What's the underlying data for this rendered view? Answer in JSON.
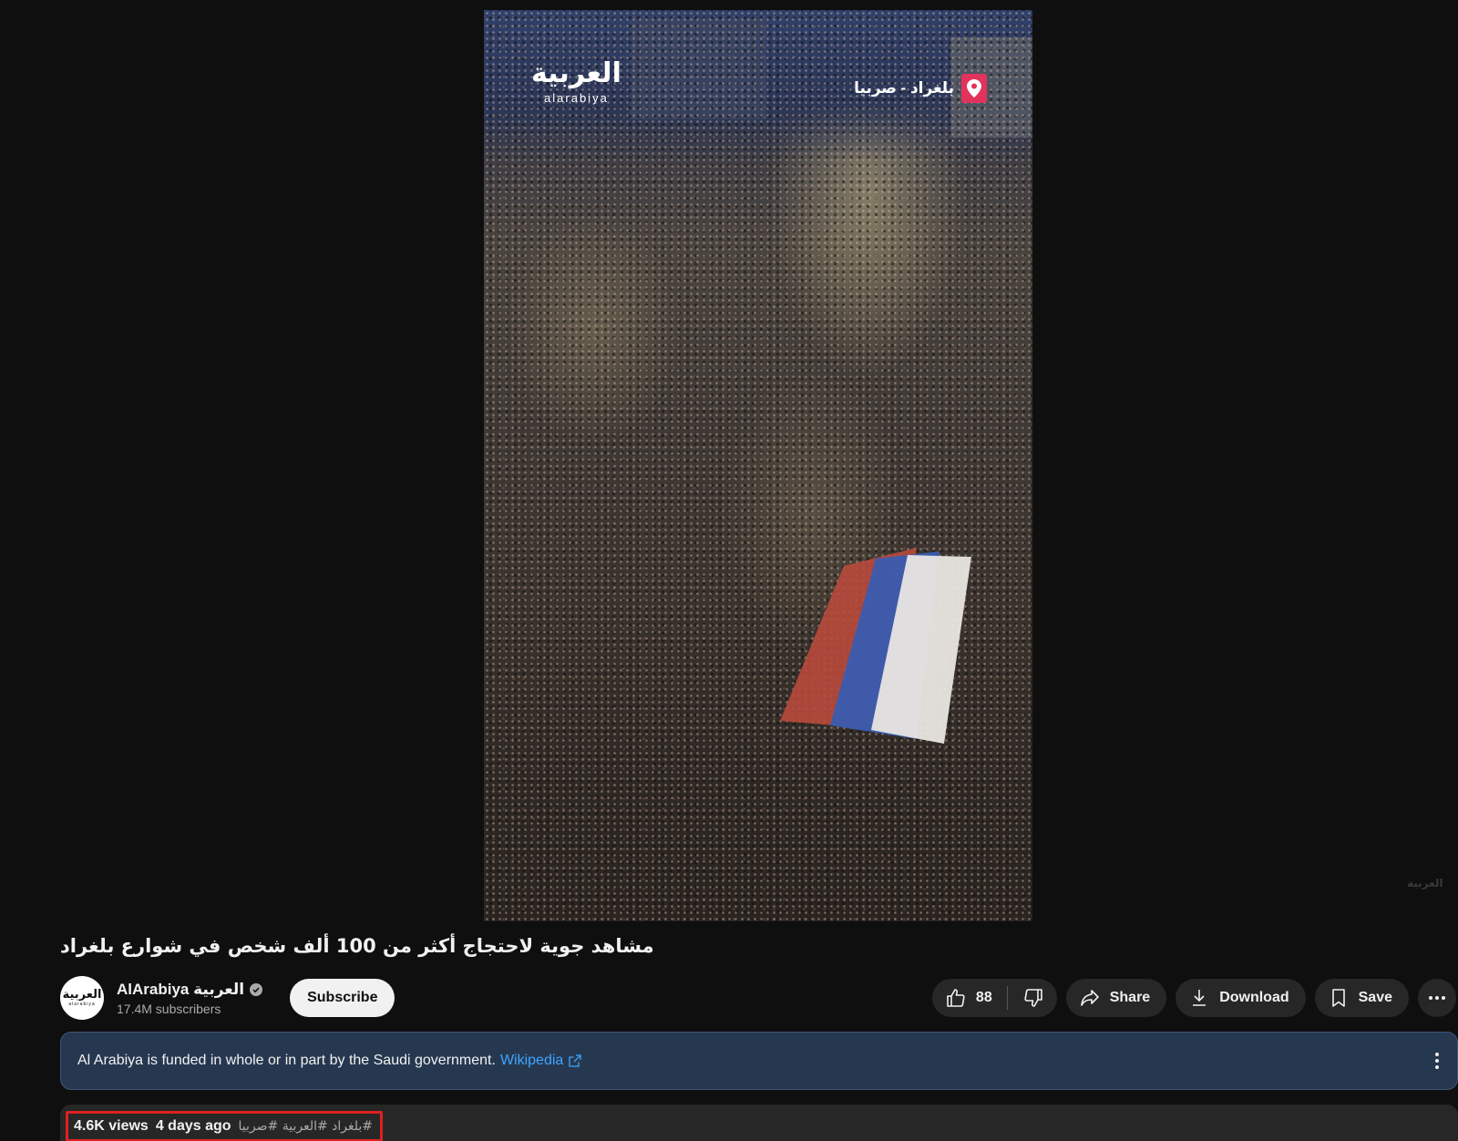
{
  "video": {
    "logo_ar": "العربية",
    "logo_en": "alarabiya",
    "location": "بلغراد - صربيا",
    "corner_watermark": "العربية",
    "title": "مشاهد جوية لاحتجاج أكثر من 100 ألف شخص في شوارع بلغراد"
  },
  "channel": {
    "avatar_ar": "العربية",
    "avatar_en": "alarabiya",
    "name": "AlArabiya العربية",
    "subscribers": "17.4M subscribers",
    "subscribe_label": "Subscribe"
  },
  "actions": {
    "like_count": "88",
    "share_label": "Share",
    "download_label": "Download",
    "save_label": "Save"
  },
  "info_panel": {
    "text": "Al Arabiya is funded in whole or in part by the Saudi government.",
    "link_label": "Wikipedia"
  },
  "description": {
    "views": "4.6K views",
    "posted": "4 days ago",
    "tags": "#بلغراد #العربية #صربيا"
  }
}
